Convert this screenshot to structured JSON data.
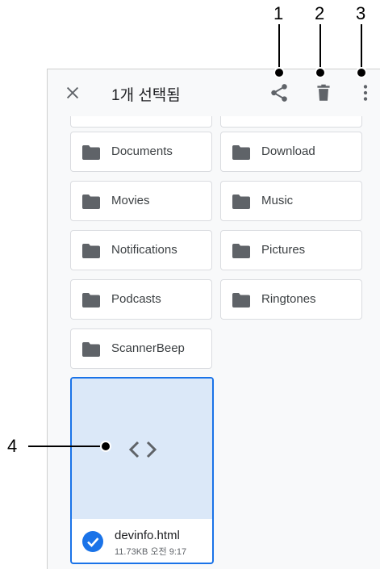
{
  "appbar": {
    "title": "1개 선택됨",
    "close_icon": "close-icon",
    "share_icon": "share-icon",
    "delete_icon": "delete-icon",
    "more_icon": "more-vert-icon"
  },
  "folders": [
    {
      "name": "Documents"
    },
    {
      "name": "Download"
    },
    {
      "name": "Movies"
    },
    {
      "name": "Music"
    },
    {
      "name": "Notifications"
    },
    {
      "name": "Pictures"
    },
    {
      "name": "Podcasts"
    },
    {
      "name": "Ringtones"
    },
    {
      "name": "ScannerBeep"
    }
  ],
  "file": {
    "name": "devinfo.html",
    "meta": "11.73KB 오전 9:17",
    "icon": "code-icon",
    "selected": true
  },
  "callouts": [
    "1",
    "2",
    "3",
    "4"
  ],
  "colors": {
    "accent": "#1a73e8",
    "thumb_bg": "#dbe8f8",
    "folder": "#5f6368"
  }
}
